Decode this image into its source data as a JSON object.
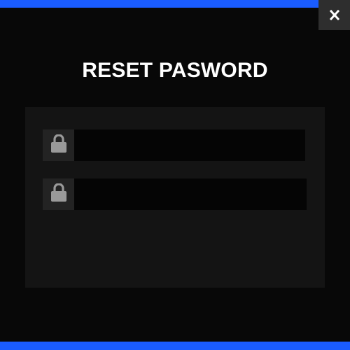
{
  "modal": {
    "title": "RESET PASWORD",
    "close_icon": "close-icon"
  },
  "form": {
    "fields": [
      {
        "icon": "lock-icon",
        "value": "",
        "placeholder": ""
      },
      {
        "icon": "lock-icon",
        "value": "",
        "placeholder": ""
      }
    ]
  },
  "colors": {
    "accent": "#1a5cff",
    "background": "#080808",
    "panel": "#141414",
    "icon_box": "#232323",
    "input": "#050505",
    "icon": "#9a9a9a",
    "title": "#ffffff"
  }
}
